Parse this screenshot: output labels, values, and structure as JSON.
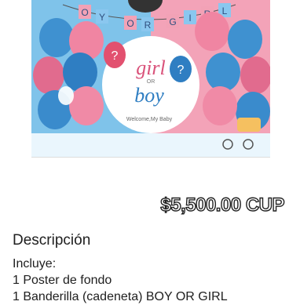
{
  "product": {
    "image_alt": "Decoración Boy or Girl",
    "banner_letters": [
      "O",
      "Y",
      "O",
      "R",
      "G",
      "I",
      "R",
      "L"
    ],
    "poster_title_top": "girl",
    "poster_title_mid": "OR",
    "poster_title_bottom": "boy",
    "poster_subtitle": "Welcome,My Baby",
    "balloon_mark": "?"
  },
  "price": "$5,500.00 CUP",
  "description": {
    "title": "Descripción",
    "lines": [
      "Incluye:",
      "1 Poster de fondo",
      "1 Banderilla (cadeneta) BOY OR GIRL"
    ]
  },
  "colors": {
    "pink": "#e8869c",
    "blue": "#3c8fcf",
    "background": "#ffffff"
  }
}
